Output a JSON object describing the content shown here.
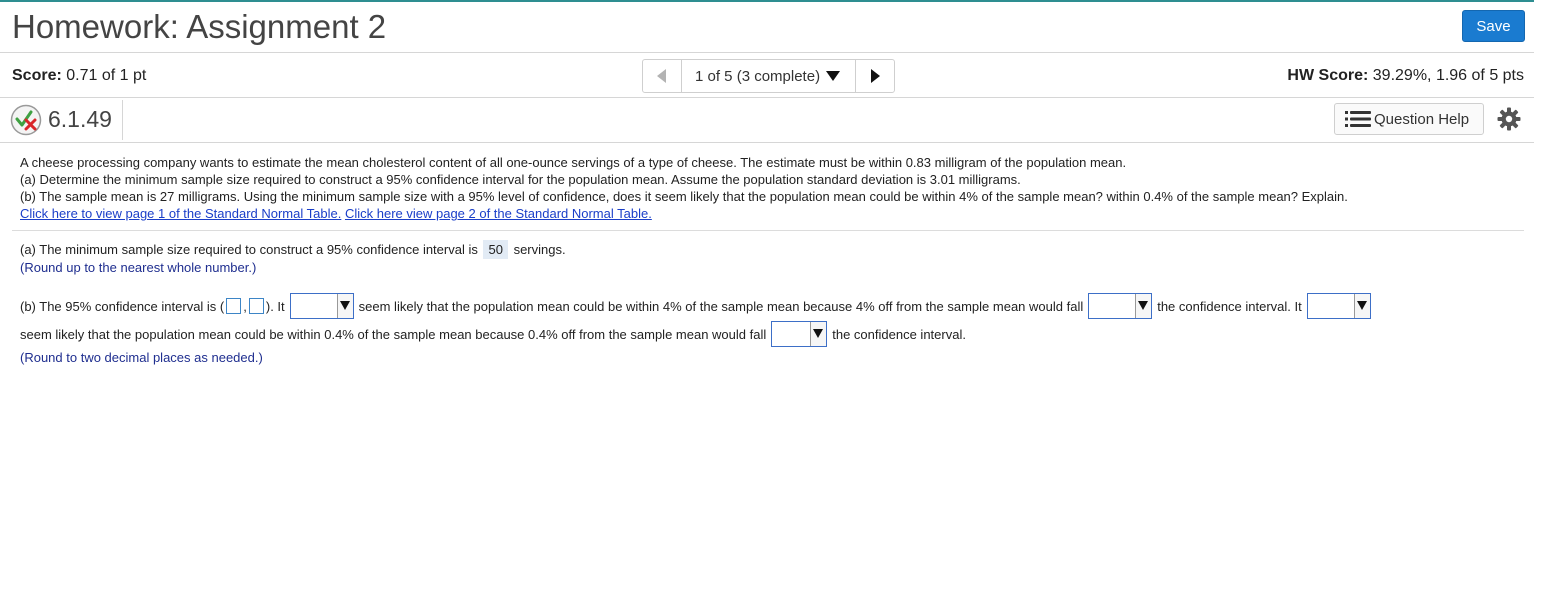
{
  "header": {
    "title": "Homework: Assignment 2",
    "save_label": "Save"
  },
  "score": {
    "label": "Score:",
    "value": "0.71 of 1 pt",
    "hw_label": "HW Score:",
    "hw_value": "39.29%, 1.96 of 5 pts"
  },
  "nav": {
    "current": "1 of 5 (3 complete)"
  },
  "question": {
    "number": "6.1.49",
    "help_label": "Question Help"
  },
  "problem": {
    "text1": "A cheese processing company wants to estimate the mean cholesterol content of all one-ounce servings of a type of cheese. The estimate must be within 0.83 milligram of the population mean.",
    "text2": "(a) Determine the minimum sample size required to construct a 95% confidence interval for the population mean. Assume the population standard deviation is 3.01 milligrams.",
    "text3": "(b) The sample mean is 27 milligrams. Using the minimum sample size with a 95% level of confidence, does it seem likely that the population mean could be within 4% of the sample mean? within 0.4% of the sample mean? Explain.",
    "link1": "Click here to view page 1 of the Standard Normal Table.",
    "link2": "Click here view page 2 of the Standard Normal Table."
  },
  "answer_a": {
    "prefix": "(a) The minimum sample size required to construct a 95% confidence interval is",
    "value": "50",
    "suffix": "servings.",
    "hint": "(Round up to the nearest whole number.)"
  },
  "answer_b": {
    "p1": "(b) The 95% confidence interval is (",
    "comma": ",",
    "p2": "). It",
    "p3": "seem likely that the population mean could be within 4% of the sample mean because 4% off from the sample mean would fall",
    "p4": "the confidence interval. It",
    "p5": "seem likely that the population mean could be within 0.4% of the sample mean because 0.4% off from the sample mean would fall",
    "p6": "the confidence interval.",
    "hint": "(Round to two decimal places as needed.)"
  },
  "colors": {
    "accent": "#1a7bd0",
    "topline": "#2e8e91",
    "link": "#1a3ec8",
    "hint": "#1f2e8f"
  }
}
